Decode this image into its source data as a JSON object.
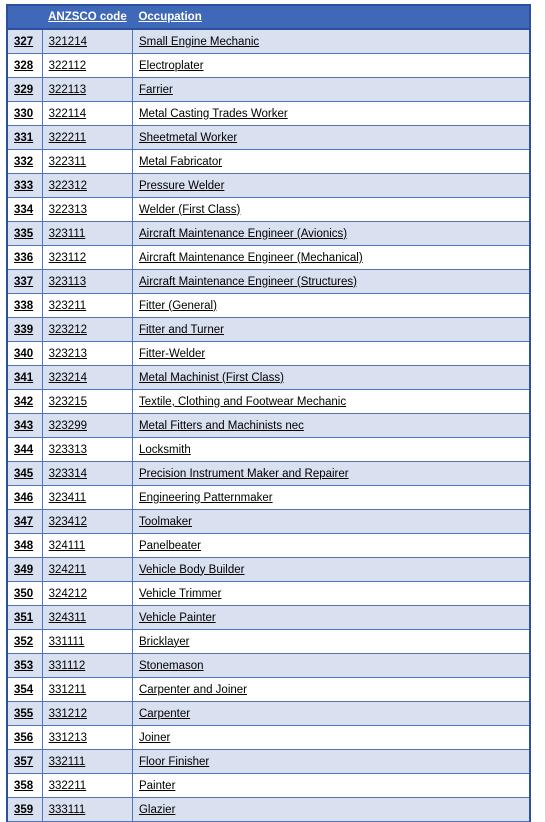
{
  "table": {
    "columns": [
      {
        "key": "index",
        "label": ""
      },
      {
        "key": "code",
        "label": "ANZSCO code"
      },
      {
        "key": "occupation",
        "label": "Occupation"
      }
    ],
    "colors": {
      "header_bg": "#3f68b8",
      "header_text": "#ffffff",
      "row_alt_bg": "#d9e0f0",
      "row_bg": "#ffffff",
      "border": "#5076c0",
      "outer_border": "#2c4f9e",
      "text": "#000000"
    },
    "rows": [
      {
        "index": "327",
        "code": "321214",
        "occupation": "Small Engine Mechanic"
      },
      {
        "index": "328",
        "code": "322112",
        "occupation": "Electroplater"
      },
      {
        "index": "329",
        "code": "322113",
        "occupation": "Farrier"
      },
      {
        "index": "330",
        "code": "322114",
        "occupation": "Metal Casting Trades Worker"
      },
      {
        "index": "331",
        "code": "322211",
        "occupation": "Sheetmetal Worker"
      },
      {
        "index": "332",
        "code": "322311",
        "occupation": "Metal Fabricator"
      },
      {
        "index": "333",
        "code": "322312",
        "occupation": "Pressure Welder"
      },
      {
        "index": "334",
        "code": "322313",
        "occupation": "Welder (First Class)"
      },
      {
        "index": "335",
        "code": "323111",
        "occupation": "Aircraft Maintenance Engineer (Avionics)"
      },
      {
        "index": "336",
        "code": "323112",
        "occupation": "Aircraft Maintenance Engineer (Mechanical)"
      },
      {
        "index": "337",
        "code": "323113",
        "occupation": "Aircraft Maintenance Engineer (Structures)"
      },
      {
        "index": "338",
        "code": "323211",
        "occupation": "Fitter (General)"
      },
      {
        "index": "339",
        "code": "323212",
        "occupation": "Fitter and Turner"
      },
      {
        "index": "340",
        "code": "323213",
        "occupation": "Fitter-Welder"
      },
      {
        "index": "341",
        "code": "323214",
        "occupation": "Metal Machinist (First Class)"
      },
      {
        "index": "342",
        "code": "323215",
        "occupation": "Textile, Clothing and Footwear Mechanic"
      },
      {
        "index": "343",
        "code": "323299",
        "occupation": "Metal Fitters and Machinists nec"
      },
      {
        "index": "344",
        "code": "323313",
        "occupation": "Locksmith"
      },
      {
        "index": "345",
        "code": "323314",
        "occupation": "Precision Instrument Maker and Repairer"
      },
      {
        "index": "346",
        "code": "323411",
        "occupation": "Engineering Patternmaker"
      },
      {
        "index": "347",
        "code": "323412",
        "occupation": "Toolmaker"
      },
      {
        "index": "348",
        "code": "324111",
        "occupation": "Panelbeater"
      },
      {
        "index": "349",
        "code": "324211",
        "occupation": "Vehicle Body Builder"
      },
      {
        "index": "350",
        "code": "324212",
        "occupation": "Vehicle Trimmer"
      },
      {
        "index": "351",
        "code": "324311",
        "occupation": "Vehicle Painter"
      },
      {
        "index": "352",
        "code": "331111",
        "occupation": "Bricklayer"
      },
      {
        "index": "353",
        "code": "331112",
        "occupation": "Stonemason"
      },
      {
        "index": "354",
        "code": "331211",
        "occupation": "Carpenter and Joiner"
      },
      {
        "index": "355",
        "code": "331212",
        "occupation": "Carpenter"
      },
      {
        "index": "356",
        "code": "331213",
        "occupation": "Joiner"
      },
      {
        "index": "357",
        "code": "332111",
        "occupation": "Floor Finisher"
      },
      {
        "index": "358",
        "code": "332211",
        "occupation": "Painter"
      },
      {
        "index": "359",
        "code": "333111",
        "occupation": "Glazier"
      }
    ]
  }
}
